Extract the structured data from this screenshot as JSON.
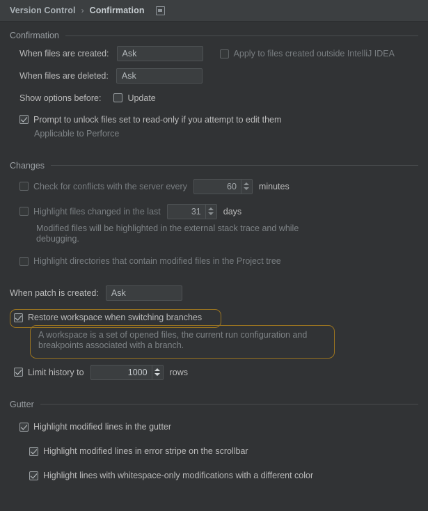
{
  "header": {
    "breadcrumb_root": "Version Control",
    "breadcrumb_separator": "›",
    "breadcrumb_leaf": "Confirmation",
    "icon": "reset-window-icon"
  },
  "sections": {
    "confirmation": {
      "title": "Confirmation",
      "when_created_label": "When files are created:",
      "when_created_value": "Ask",
      "apply_outside_label": "Apply to files created outside IntelliJ IDEA",
      "apply_outside_checked": false,
      "when_deleted_label": "When files are deleted:",
      "when_deleted_value": "Ask",
      "show_options_label": "Show options before:",
      "update_label": "Update",
      "update_checked": false,
      "prompt_unlock_label": "Prompt to unlock files set to read-only if you attempt to edit them",
      "prompt_unlock_checked": true,
      "prompt_unlock_note": "Applicable to Perforce"
    },
    "changes": {
      "title": "Changes",
      "check_conflicts_label": "Check for conflicts with the server every",
      "check_conflicts_checked": false,
      "check_conflicts_value": "60",
      "check_conflicts_unit": "minutes",
      "highlight_files_label": "Highlight files changed in the last",
      "highlight_files_checked": false,
      "highlight_files_value": "31",
      "highlight_files_unit": "days",
      "highlight_files_note": "Modified files will be highlighted in the external stack trace and while debugging.",
      "highlight_dirs_label": "Highlight directories that contain modified files in the Project tree",
      "highlight_dirs_checked": false,
      "when_patch_label": "When patch is created:",
      "when_patch_value": "Ask",
      "restore_workspace_label": "Restore workspace when switching branches",
      "restore_workspace_checked": true,
      "restore_workspace_note": "A workspace is a set of opened files, the current run configuration and breakpoints associated with a branch.",
      "limit_history_label": "Limit history to",
      "limit_history_checked": true,
      "limit_history_value": "1000",
      "limit_history_unit": "rows"
    },
    "gutter": {
      "title": "Gutter",
      "highlight_gutter_label": "Highlight modified lines in the gutter",
      "highlight_gutter_checked": true,
      "highlight_stripe_label": "Highlight modified lines in error stripe on the scrollbar",
      "highlight_stripe_checked": true,
      "highlight_whitespace_label": "Highlight lines with whitespace-only modifications with a different color",
      "highlight_whitespace_checked": true
    }
  },
  "colors": {
    "background": "#313335",
    "header_background": "#3c3f41",
    "text": "#bbbbbb",
    "dim_text": "#7e8386",
    "highlight_outline": "#9c7520",
    "field_background": "#3b3e40"
  }
}
